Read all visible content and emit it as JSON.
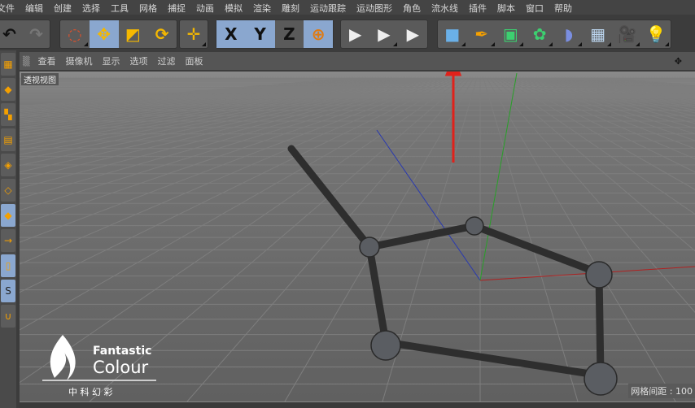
{
  "menu": [
    "文件",
    "编辑",
    "创建",
    "选择",
    "工具",
    "网格",
    "捕捉",
    "动画",
    "模拟",
    "渲染",
    "雕刻",
    "运动跟踪",
    "运动图形",
    "角色",
    "流水线",
    "插件",
    "脚本",
    "窗口",
    "帮助"
  ],
  "toolbar": {
    "undo": "undo-icon",
    "redo": "redo-icon",
    "axis_x": "X",
    "axis_y": "Y",
    "axis_z": "Z"
  },
  "viewport_menu": [
    "查看",
    "摄像机",
    "显示",
    "选项",
    "过滤",
    "面板"
  ],
  "viewport_label": "透视视图",
  "grid_info": "网格间距 : 100",
  "logo": {
    "line1": "Fantastic",
    "line2": "Colour",
    "line3": "中 科 幻 彩"
  },
  "colors": {
    "accent_selected": "#8aa7cf",
    "icon_orange": "#f5b800",
    "arrow": "#e0221b"
  }
}
